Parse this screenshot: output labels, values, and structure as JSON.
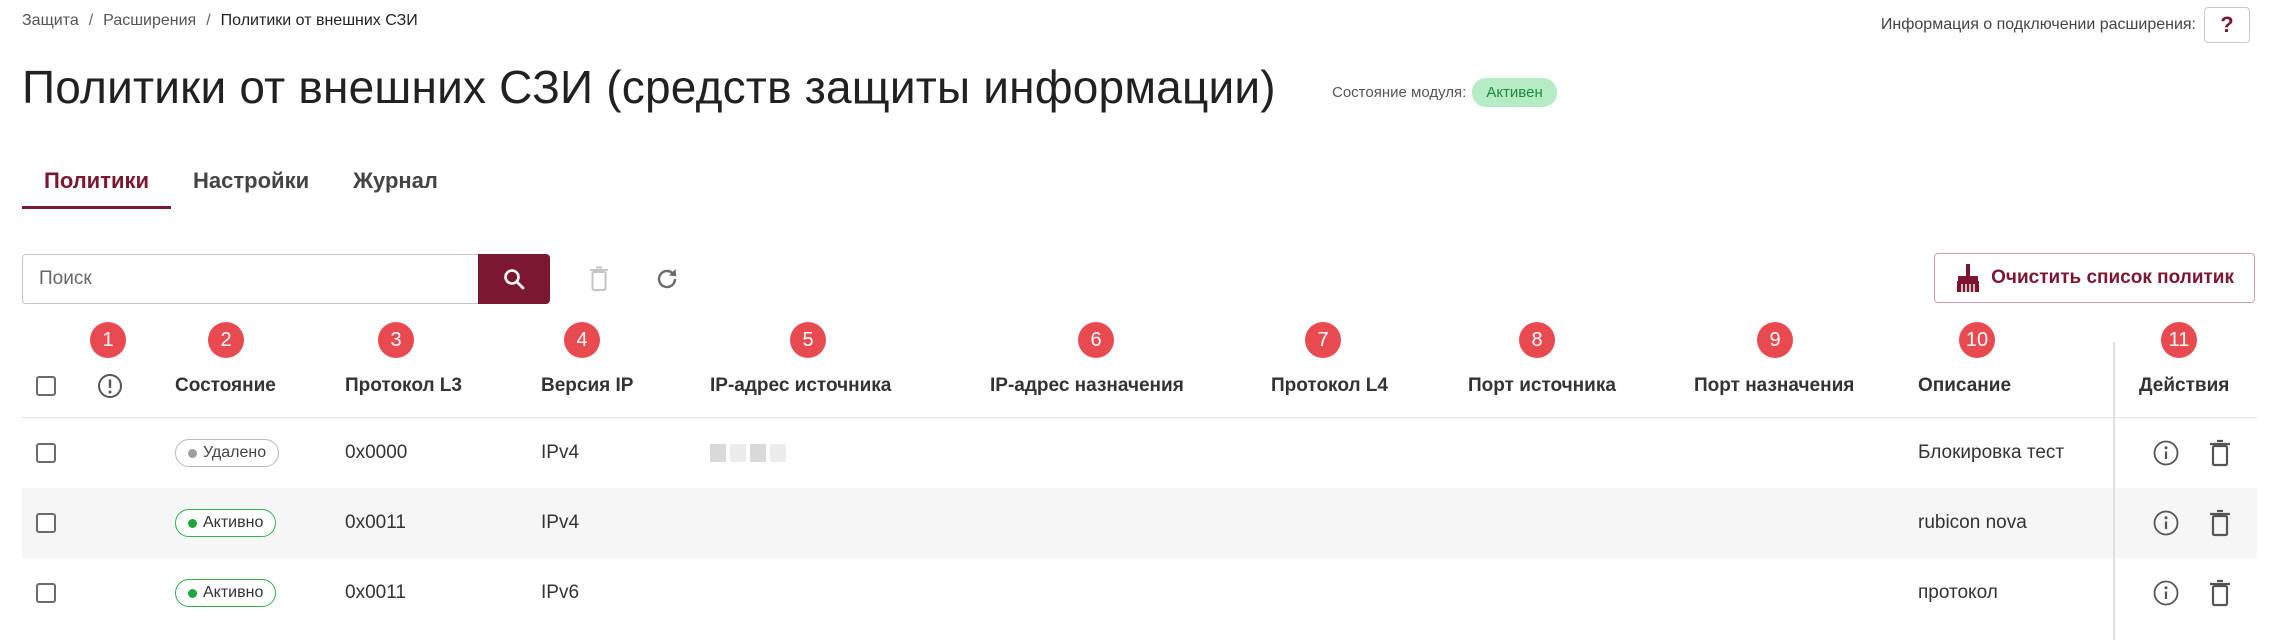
{
  "breadcrumb": {
    "item1": "Защита",
    "item2": "Расширения",
    "current": "Политики от внешних СЗИ",
    "sep": "/"
  },
  "help": {
    "label": "Информация о подключении расширения:",
    "button": "?"
  },
  "title": "Политики от внешних СЗИ (средств защиты информации)",
  "module_state": {
    "label": "Состояние модуля:",
    "value": "Активен"
  },
  "tabs": [
    {
      "label": "Политики",
      "active": true
    },
    {
      "label": "Настройки",
      "active": false
    },
    {
      "label": "Журнал",
      "active": false
    }
  ],
  "search": {
    "placeholder": "Поиск",
    "value": ""
  },
  "clear_button": {
    "label": "Очистить список политик"
  },
  "columns": [
    {
      "num": "1",
      "label": ""
    },
    {
      "num": "2",
      "label": "Состояние"
    },
    {
      "num": "3",
      "label": "Протокол L3"
    },
    {
      "num": "4",
      "label": "Версия IP"
    },
    {
      "num": "5",
      "label": "IP-адрес источника"
    },
    {
      "num": "6",
      "label": "IP-адрес назначения"
    },
    {
      "num": "7",
      "label": "Протокол L4"
    },
    {
      "num": "8",
      "label": "Порт источника"
    },
    {
      "num": "9",
      "label": "Порт назначения"
    },
    {
      "num": "10",
      "label": "Описание"
    },
    {
      "num": "11",
      "label": "Действия"
    }
  ],
  "rows": [
    {
      "state": "Удалено",
      "state_kind": "deleted",
      "l3": "0x0000",
      "ip_version": "IPv4",
      "src_ip": "masked",
      "dst_ip": "",
      "l4": "",
      "src_port": "",
      "dst_port": "",
      "description": "Блокировка тест"
    },
    {
      "state": "Активно",
      "state_kind": "active",
      "l3": "0x0011",
      "ip_version": "IPv4",
      "src_ip": "",
      "dst_ip": "",
      "l4": "",
      "src_port": "",
      "dst_port": "",
      "description": "rubicon nova"
    },
    {
      "state": "Активно",
      "state_kind": "active",
      "l3": "0x0011",
      "ip_version": "IPv6",
      "src_ip": "",
      "dst_ip": "",
      "l4": "",
      "src_port": "",
      "dst_port": "",
      "description": "протокол"
    }
  ],
  "colors": {
    "accent": "#7b1730",
    "badge": "#e84a4f",
    "active_green": "#2bb24c",
    "module_badge_bg": "#b6ecc5"
  }
}
